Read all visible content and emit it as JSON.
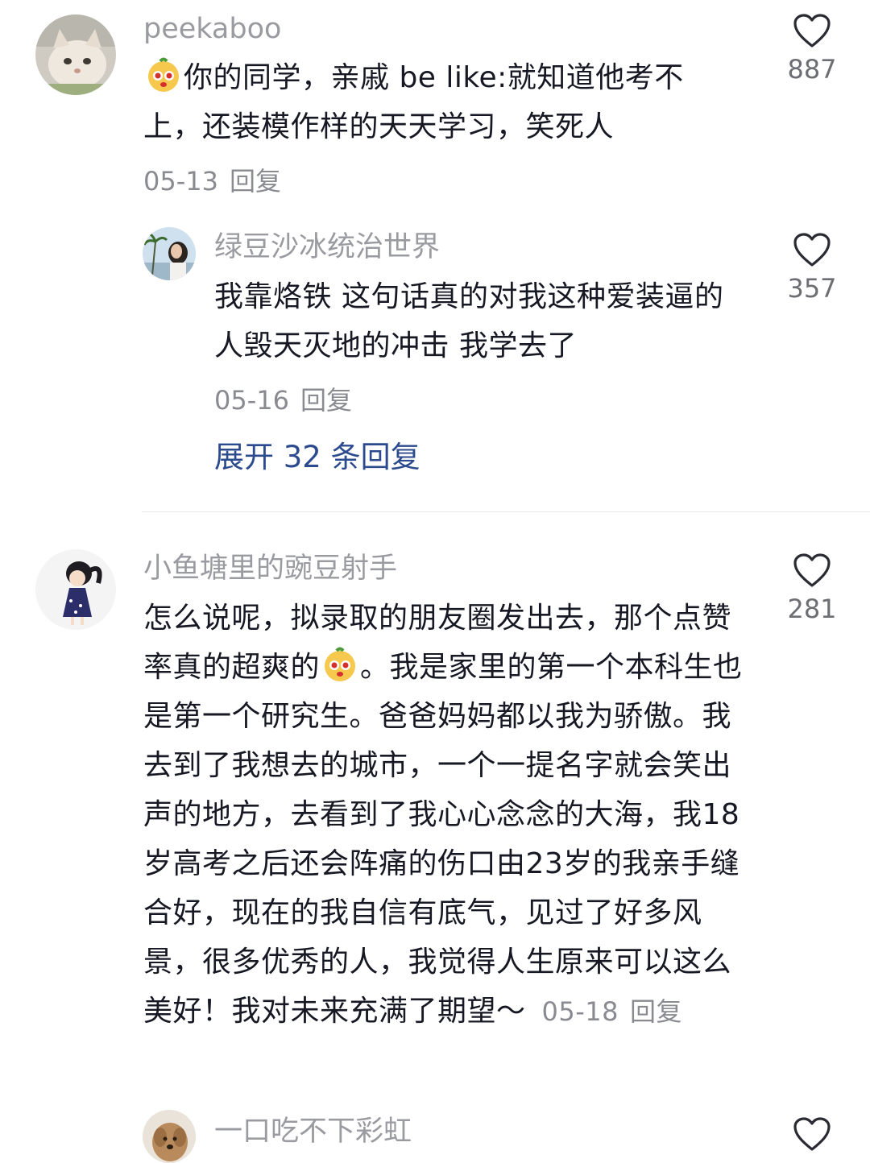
{
  "comments": [
    {
      "username": "peekaboo",
      "avatar": "cat-avatar",
      "text_pre": "",
      "emoji": "sticker-emoji",
      "text": "你的同学，亲戚 be like:就知道他考不上，还装模作样的天天学习，笑死人",
      "date": "05-13",
      "reply_label": "回复",
      "likes": "887"
    },
    {
      "username": "绿豆沙冰统治世界",
      "avatar": "girl-palm-avatar",
      "text": "我靠烙铁 这句话真的对我这种爱装逼的人毁天灭地的冲击 我学去了",
      "date": "05-16",
      "reply_label": "回复",
      "likes": "357"
    },
    {
      "username": "小鱼塘里的豌豆射手",
      "avatar": "cartoon-girl-avatar",
      "text_pre": "怎么说呢，拟录取的朋友圈发出去，那个点赞率真的超爽的",
      "emoji": "sticker-emoji",
      "text_post": "。我是家里的第一个本科生也是第一个研究生。爸爸妈妈都以我为骄傲。我去到了我想去的城市，一个一提名字就会笑出声的地方，去看到了我心心念念的大海，我18岁高考之后还会阵痛的伤口由23岁的我亲手缝合好，现在的我自信有底气，见过了好多风景，很多优秀的人，我觉得人生原来可以这么美好！我对未来充满了期望～",
      "date": "05-18",
      "reply_label": "回复",
      "likes": "281"
    },
    {
      "username": "一口吃不下彩虹",
      "avatar": "dog-avatar"
    }
  ],
  "expand_replies": "展开 32 条回复",
  "colors": {
    "username": "#9a9ba0",
    "link": "#2c4a8e",
    "meta": "#8a8b91",
    "text": "#161823"
  }
}
